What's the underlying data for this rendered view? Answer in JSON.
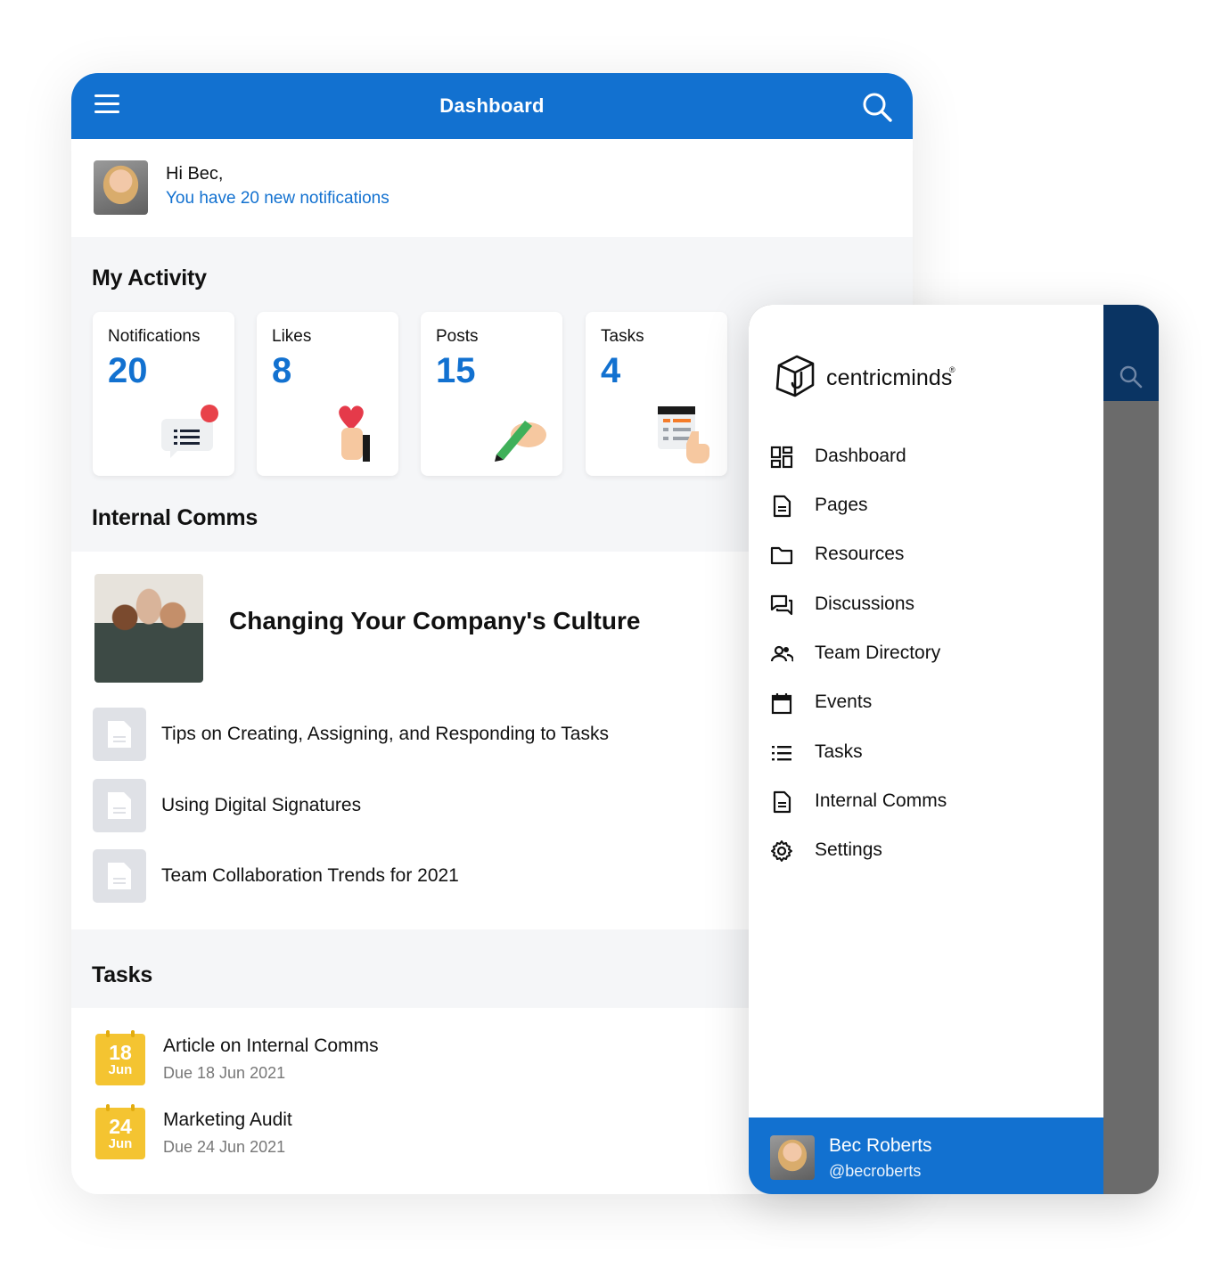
{
  "dashboard": {
    "title": "Dashboard",
    "greeting": "Hi Bec,",
    "notifications_text": "You have 20 new notifications",
    "activity_title": "My Activity",
    "activity_cards": [
      {
        "label": "Notifications",
        "value": "20",
        "icon": "chat-notification-icon"
      },
      {
        "label": "Likes",
        "value": "8",
        "icon": "heart-hand-icon"
      },
      {
        "label": "Posts",
        "value": "15",
        "icon": "pen-hand-icon"
      },
      {
        "label": "Tasks",
        "value": "4",
        "icon": "checklist-hand-icon"
      }
    ],
    "comms_title": "Internal Comms",
    "featured_article": "Changing Your Company's Culture",
    "articles": [
      "Tips on Creating, Assigning, and Responding to Tasks",
      "Using Digital Signatures",
      "Team Collaboration Trends for 2021"
    ],
    "tasks_title": "Tasks",
    "tasks": [
      {
        "day": "18",
        "month": "Jun",
        "title": "Article on Internal Comms",
        "due": "Due 18 Jun 2021"
      },
      {
        "day": "24",
        "month": "Jun",
        "title": "Marketing Audit",
        "due": "Due 24 Jun 2021"
      }
    ]
  },
  "drawer": {
    "brand": "centricminds",
    "brand_mark": "®",
    "nav": [
      {
        "label": "Dashboard",
        "icon": "dashboard-icon"
      },
      {
        "label": "Pages",
        "icon": "page-icon"
      },
      {
        "label": "Resources",
        "icon": "folder-icon"
      },
      {
        "label": "Discussions",
        "icon": "discussion-icon"
      },
      {
        "label": "Team Directory",
        "icon": "people-icon"
      },
      {
        "label": "Events",
        "icon": "calendar-icon"
      },
      {
        "label": "Tasks",
        "icon": "list-icon"
      },
      {
        "label": "Internal Comms",
        "icon": "document-icon"
      },
      {
        "label": "Settings",
        "icon": "gear-icon"
      }
    ],
    "profile": {
      "name": "Bec Roberts",
      "handle": "@becroberts"
    }
  },
  "colors": {
    "primary": "#1271d0",
    "dark_header": "#0a3463",
    "task_badge": "#f4c431",
    "background": "#f5f6f8"
  }
}
